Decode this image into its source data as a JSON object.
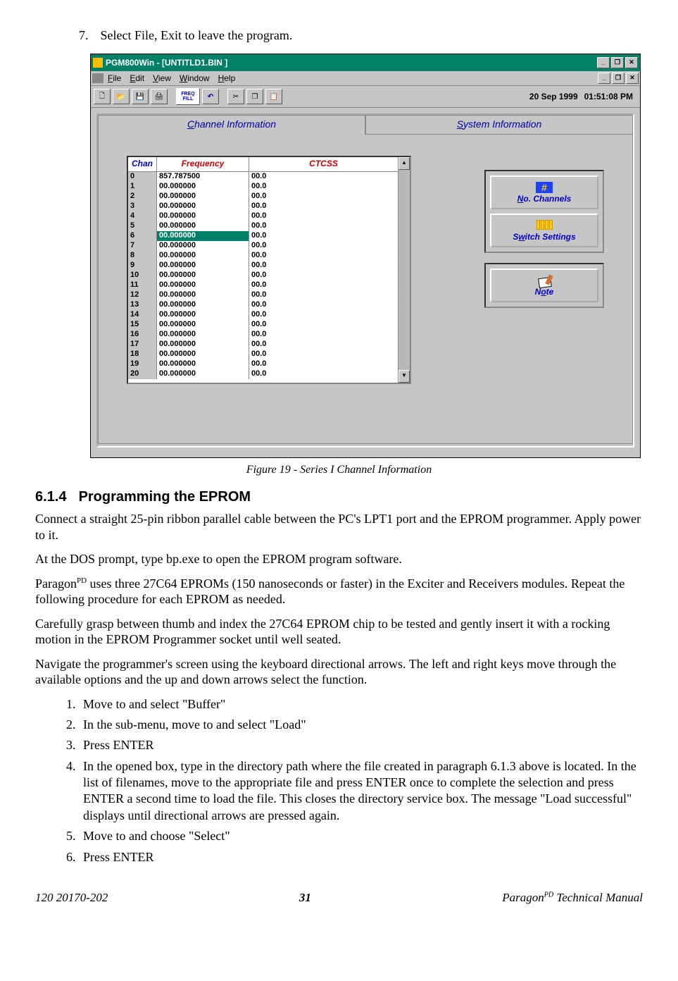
{
  "step7": {
    "num": "7.",
    "text": "Select File, Exit to leave the program."
  },
  "app": {
    "title": "PGM800Win - [UNTITLD1.BIN                                  ]",
    "date": "20 Sep 1999",
    "time": "01:51:08 PM",
    "menu": {
      "file": "File",
      "edit": "Edit",
      "view": "View",
      "window": "Window",
      "help": "Help"
    },
    "freqfill": "FREQ FILL",
    "tabs": {
      "chan": "Channel Information",
      "sys": "System Information"
    },
    "table": {
      "headers": {
        "chan": "Chan",
        "freq": "Frequency",
        "ctcss": "CTCSS"
      },
      "rows": [
        {
          "chan": "0",
          "freq": "857.787500",
          "ctcss": "00.0"
        },
        {
          "chan": "1",
          "freq": "00.000000",
          "ctcss": "00.0"
        },
        {
          "chan": "2",
          "freq": "00.000000",
          "ctcss": "00.0"
        },
        {
          "chan": "3",
          "freq": "00.000000",
          "ctcss": "00.0"
        },
        {
          "chan": "4",
          "freq": "00.000000",
          "ctcss": "00.0"
        },
        {
          "chan": "5",
          "freq": "00.000000",
          "ctcss": "00.0"
        },
        {
          "chan": "6",
          "freq": "00.000000",
          "ctcss": "00.0",
          "selected": true
        },
        {
          "chan": "7",
          "freq": "00.000000",
          "ctcss": "00.0"
        },
        {
          "chan": "8",
          "freq": "00.000000",
          "ctcss": "00.0"
        },
        {
          "chan": "9",
          "freq": "00.000000",
          "ctcss": "00.0"
        },
        {
          "chan": "10",
          "freq": "00.000000",
          "ctcss": "00.0"
        },
        {
          "chan": "11",
          "freq": "00.000000",
          "ctcss": "00.0"
        },
        {
          "chan": "12",
          "freq": "00.000000",
          "ctcss": "00.0"
        },
        {
          "chan": "13",
          "freq": "00.000000",
          "ctcss": "00.0"
        },
        {
          "chan": "14",
          "freq": "00.000000",
          "ctcss": "00.0"
        },
        {
          "chan": "15",
          "freq": "00.000000",
          "ctcss": "00.0"
        },
        {
          "chan": "16",
          "freq": "00.000000",
          "ctcss": "00.0"
        },
        {
          "chan": "17",
          "freq": "00.000000",
          "ctcss": "00.0"
        },
        {
          "chan": "18",
          "freq": "00.000000",
          "ctcss": "00.0"
        },
        {
          "chan": "19",
          "freq": "00.000000",
          "ctcss": "00.0"
        },
        {
          "chan": "20",
          "freq": "00.000000",
          "ctcss": "00.0"
        }
      ]
    },
    "buttons": {
      "nochannels": "No. Channels",
      "switchsettings": "Switch Settings",
      "note": "Note"
    }
  },
  "caption": "Figure 19 - Series I Channel Information",
  "section": {
    "num": "6.1.4",
    "title": "Programming the EPROM"
  },
  "p1": "Connect a straight 25-pin ribbon parallel cable between the PC's LPT1 port and the EPROM programmer. Apply power to it.",
  "p2": "At the DOS prompt, type bp.exe to open the EPROM program software.",
  "p3a": "Paragon",
  "p3sup": "PD",
  "p3b": " uses three 27C64 EPROMs (150 nanoseconds or faster) in the Exciter and Receivers modules. Repeat the following procedure for each EPROM as needed.",
  "p4": "Carefully grasp between thumb and index the 27C64 EPROM chip to be tested and gently insert it with a rocking motion in the EPROM Programmer socket until well seated.",
  "p5": "Navigate the programmer's screen using the keyboard directional arrows. The left and right keys move through the available options and the up and down arrows select the function.",
  "list": [
    "Move to and select \"Buffer\"",
    "In the sub-menu, move to and select \"Load\"",
    "Press ENTER",
    "In the opened box, type in the directory path where the file created in paragraph 6.1.3 above is located. In the list of filenames, move to the appropriate file and press ENTER once to complete the selection and press ENTER a second time to load the file. This closes the directory service box. The message \"Load successful\" displays until directional arrows are pressed again.",
    "Move to and choose \"Select\"",
    "Press ENTER"
  ],
  "footer": {
    "left": "120 20170-202",
    "page": "31",
    "rightA": "Paragon",
    "rightSup": "PD",
    "rightB": " Technical Manual"
  }
}
